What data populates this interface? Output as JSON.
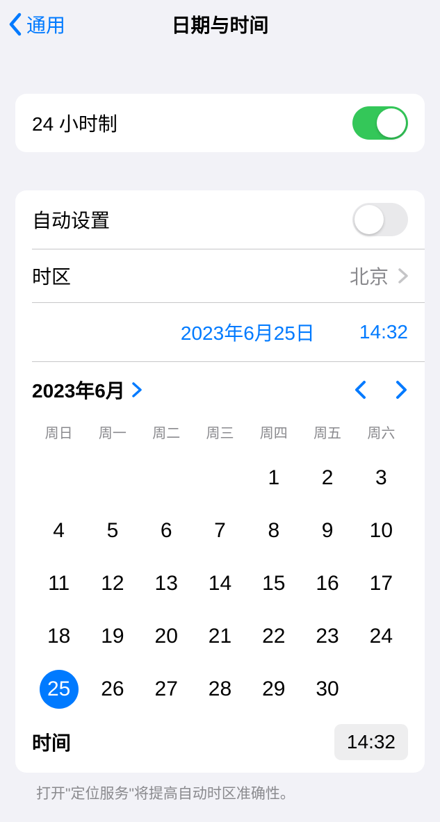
{
  "nav": {
    "back_label": "通用",
    "title": "日期与时间"
  },
  "rows": {
    "twentyfour_hour_label": "24 小时制",
    "auto_set_label": "自动设置",
    "timezone_label": "时区",
    "timezone_value": "北京"
  },
  "datetime": {
    "date_display": "2023年6月25日",
    "time_display": "14:32"
  },
  "calendar": {
    "month_label": "2023年6月",
    "weekdays": [
      "周日",
      "周一",
      "周二",
      "周三",
      "周四",
      "周五",
      "周六"
    ],
    "leading_blanks": 4,
    "days_in_month": 30,
    "selected_day": 25,
    "time_label": "时间",
    "time_value": "14:32"
  },
  "footer_note": "打开\"定位服务\"将提高自动时区准确性。"
}
